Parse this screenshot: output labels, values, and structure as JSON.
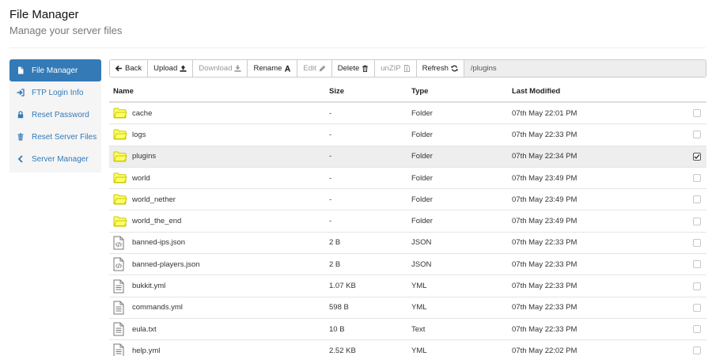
{
  "header": {
    "title": "File Manager",
    "subtitle": "Manage your server files"
  },
  "sidebar": {
    "items": [
      {
        "label": "File Manager",
        "icon": "file-icon",
        "active": true
      },
      {
        "label": "FTP Login Info",
        "icon": "sign-in-icon",
        "active": false
      },
      {
        "label": "Reset Password",
        "icon": "lock-icon",
        "active": false
      },
      {
        "label": "Reset Server Files",
        "icon": "trash-icon",
        "active": false
      },
      {
        "label": "Server Manager",
        "icon": "chevron-left-icon",
        "active": false
      }
    ]
  },
  "toolbar": {
    "back": "Back",
    "upload": "Upload",
    "download": "Download",
    "rename": "Rename",
    "edit": "Edit",
    "delete": "Delete",
    "unzip": "unZIP",
    "refresh": "Refresh",
    "path": "/plugins"
  },
  "table": {
    "columns": {
      "name": "Name",
      "size": "Size",
      "type": "Type",
      "modified": "Last Modified"
    },
    "rows": [
      {
        "name": "cache",
        "size": "-",
        "type": "Folder",
        "modified": "07th May 22:01 PM",
        "kind": "folder",
        "checked": false
      },
      {
        "name": "logs",
        "size": "-",
        "type": "Folder",
        "modified": "07th May 22:33 PM",
        "kind": "folder",
        "checked": false
      },
      {
        "name": "plugins",
        "size": "-",
        "type": "Folder",
        "modified": "07th May 22:34 PM",
        "kind": "folder",
        "checked": true
      },
      {
        "name": "world",
        "size": "-",
        "type": "Folder",
        "modified": "07th May 23:49 PM",
        "kind": "folder",
        "checked": false
      },
      {
        "name": "world_nether",
        "size": "-",
        "type": "Folder",
        "modified": "07th May 23:49 PM",
        "kind": "folder",
        "checked": false
      },
      {
        "name": "world_the_end",
        "size": "-",
        "type": "Folder",
        "modified": "07th May 23:49 PM",
        "kind": "folder",
        "checked": false
      },
      {
        "name": "banned-ips.json",
        "size": "2 B",
        "type": "JSON",
        "modified": "07th May 22:33 PM",
        "kind": "code",
        "checked": false
      },
      {
        "name": "banned-players.json",
        "size": "2 B",
        "type": "JSON",
        "modified": "07th May 22:33 PM",
        "kind": "code",
        "checked": false
      },
      {
        "name": "bukkit.yml",
        "size": "1.07 KB",
        "type": "YML",
        "modified": "07th May 22:33 PM",
        "kind": "text",
        "checked": false
      },
      {
        "name": "commands.yml",
        "size": "598 B",
        "type": "YML",
        "modified": "07th May 22:33 PM",
        "kind": "text",
        "checked": false
      },
      {
        "name": "eula.txt",
        "size": "10 B",
        "type": "Text",
        "modified": "07th May 22:33 PM",
        "kind": "text",
        "checked": false
      },
      {
        "name": "help.yml",
        "size": "2.52 KB",
        "type": "YML",
        "modified": "07th May 22:02 PM",
        "kind": "text",
        "checked": false
      }
    ]
  },
  "colors": {
    "accent": "#337ab7",
    "folder_fill": "#ffff66",
    "folder_stroke": "#c8c800",
    "selected_row": "#eeeeee"
  }
}
